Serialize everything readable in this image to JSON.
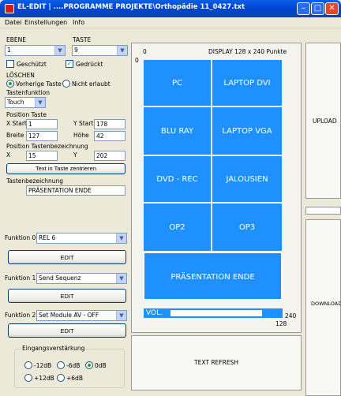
{
  "window": {
    "title": "EL-EDIT | ....PROGRAMME PROJEKTE\\Orthopädie 11_0427.txt",
    "minimize_icon": "minimize-icon",
    "maximize_icon": "maximize-icon",
    "close_icon": "close-icon"
  },
  "menu": [
    "Datei",
    "Einstellungen",
    "Info"
  ],
  "left": {
    "ebene_label": "EBENE",
    "ebene_value": "1",
    "taste_label": "TASTE",
    "taste_value": "9",
    "geschuetzt_label": "Geschützt",
    "gedrueckt_label": "Gedrückt",
    "loeschen_label": "LÖSCHEN",
    "vorherige_label": "Vorherige Taste",
    "nicht_erlaubt_label": "Nicht erlaubt",
    "tastenfunktion_label": "Tastenfunktion",
    "tastenfunktion_value": "Touch",
    "position_taste_label": "Position Taste",
    "xstart_label": "X Start",
    "xstart_value": "1",
    "ystart_label": "Y Start",
    "ystart_value": "178",
    "breite_label": "Breite",
    "breite_value": "127",
    "hoehe_label": "Höhe",
    "hoehe_value": "42",
    "pos_bez_label": "Position Tastenbezeichnung",
    "x_label": "X",
    "x_value": "15",
    "y_label": "Y",
    "y_value": "202",
    "center_button": "Text in Taste zentrieren",
    "tastenbez_label": "Tastenbezeichnung",
    "tastenbez_value": "PRÄSENTATION  ENDE"
  },
  "functions": [
    {
      "label": "Funktion 0",
      "value": "REL 6",
      "edit": "EDIT"
    },
    {
      "label": "Funktion 1",
      "value": "Send Sequenz",
      "edit": "EDIT"
    },
    {
      "label": "Funktion 2",
      "value": "Set Module AV - OFF",
      "edit": "EDIT"
    }
  ],
  "eingang": {
    "title": "Eingangsverstärkung",
    "options": [
      "-12dB",
      "-6dB",
      "0dB",
      "+12dB",
      "+6dB"
    ],
    "selected": "0dB"
  },
  "display": {
    "header": "DISPLAY 128 x 240 Punkte",
    "origin_x": "0",
    "origin_y": "0",
    "max_y": "240",
    "max_x": "128",
    "buttons": [
      "PC",
      "LAPTOP DVI",
      "BLU RAY",
      "LAPTOP VGA",
      "DVD - REC",
      "JALOUSIEN",
      "OP2",
      "OP3",
      "PRÄSENTATION  ENDE"
    ],
    "vol_label": "VOL.",
    "accent": "#1e90ff"
  },
  "right": {
    "upload": "UPLOAD",
    "download": "DOWNLOAD",
    "text_refresh": "TEXT REFRESH"
  }
}
